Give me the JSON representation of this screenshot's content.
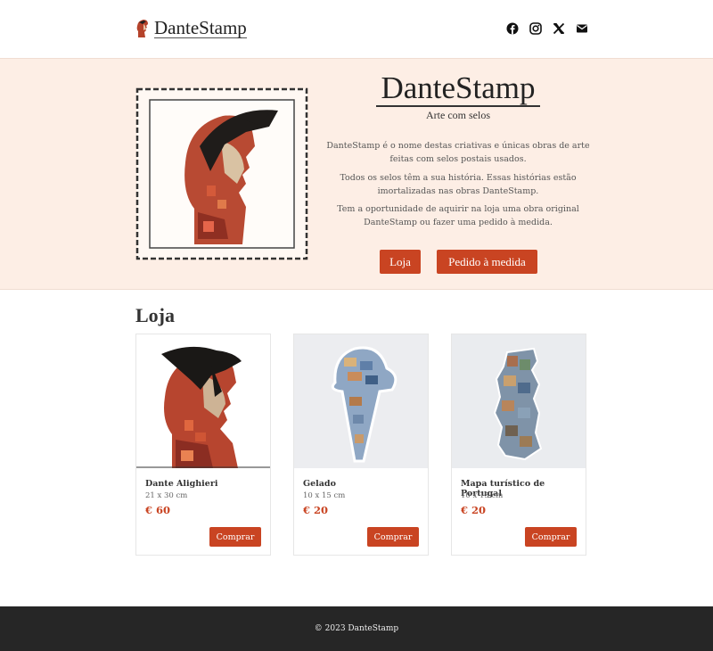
{
  "header": {
    "brand_name": "DanteStamp",
    "social_icons": [
      "facebook-icon",
      "instagram-icon",
      "x-icon",
      "envelope-icon"
    ]
  },
  "hero": {
    "title": "DanteStamp",
    "subtitle": "Arte com selos",
    "paragraphs": [
      "DanteStamp é o nome destas criativas e únicas obras de arte feitas com selos postais usados.",
      "Todos os selos têm a sua história. Essas histórias estão imortalizadas nas obras DanteStamp.",
      "Tem a oportunidade de aquirir na loja uma obra original DanteStamp ou fazer uma pedido à medida."
    ],
    "buttons": {
      "shop": "Loja",
      "custom": "Pedido à medida"
    }
  },
  "shop": {
    "title": "Loja",
    "products": [
      {
        "name": "Dante Alighieri",
        "size": "21 x 30 cm",
        "price": "€ 60",
        "button": "Comprar"
      },
      {
        "name": "Gelado",
        "size": "10 x 15 cm",
        "price": "€ 20",
        "button": "Comprar"
      },
      {
        "name": "Mapa turístico de Portugal",
        "size": "10 x 15 cm",
        "price": "€ 20",
        "button": "Comprar"
      }
    ]
  },
  "footer": {
    "copyright": "© 2023 DanteStamp"
  },
  "colors": {
    "accent": "#c94422",
    "hero_background": "#fdeee5",
    "footer_background": "#262626"
  }
}
